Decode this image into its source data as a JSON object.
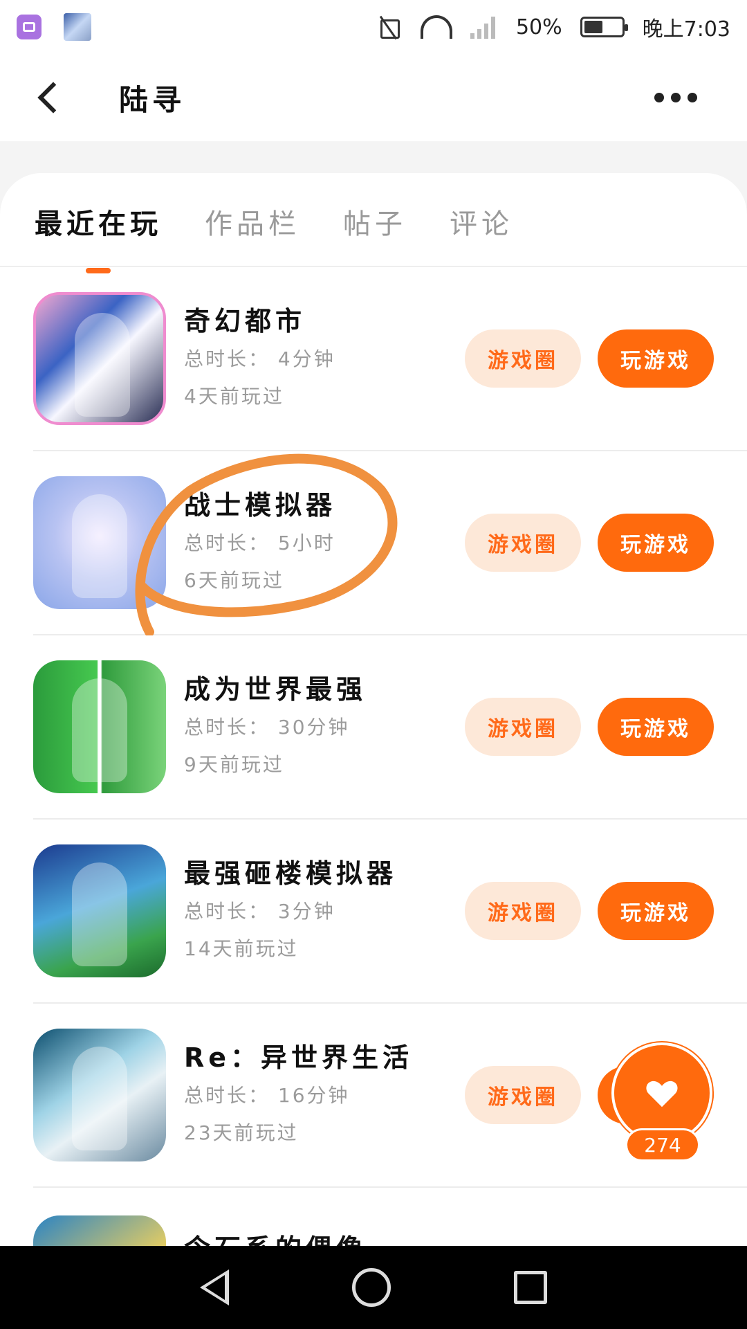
{
  "status_bar": {
    "battery": "50%",
    "time": "晚上7:03",
    "icons": [
      "image-app-icon",
      "photo-thumbnail-icon",
      "mute-icon",
      "wifi-icon",
      "signal-icon",
      "battery-icon"
    ]
  },
  "header": {
    "title": "陆寻"
  },
  "tabs": [
    {
      "label": "最近在玩",
      "active": true
    },
    {
      "label": "作品栏",
      "active": false
    },
    {
      "label": "帖子",
      "active": false
    },
    {
      "label": "评论",
      "active": false
    }
  ],
  "games": [
    {
      "name": "奇幻都市",
      "duration": "总时长：  4分钟",
      "last_played": "4天前玩过",
      "circle_label": "游戏圈",
      "play_label": "玩游戏"
    },
    {
      "name": "战士模拟器",
      "duration": "总时长：  5小时",
      "last_played": "6天前玩过",
      "circle_label": "游戏圈",
      "play_label": "玩游戏"
    },
    {
      "name": "成为世界最强",
      "duration": "总时长：  30分钟",
      "last_played": "9天前玩过",
      "circle_label": "游戏圈",
      "play_label": "玩游戏"
    },
    {
      "name": "最强砸楼模拟器",
      "duration": "总时长：  3分钟",
      "last_played": "14天前玩过",
      "circle_label": "游戏圈",
      "play_label": "玩游戏"
    },
    {
      "name": "Re：异世界生活",
      "duration": "总时长：  16分钟",
      "last_played": "23天前玩过",
      "circle_label": "游戏圈",
      "play_label": ""
    },
    {
      "name": "令石系的偶像",
      "duration": "",
      "last_played": "",
      "circle_label": "",
      "play_label": ""
    }
  ],
  "like_button": {
    "count": "274"
  },
  "colors": {
    "accent": "#ff6a0d",
    "accent_soft_bg": "#fde8d8",
    "annotation": "#f0913f"
  }
}
